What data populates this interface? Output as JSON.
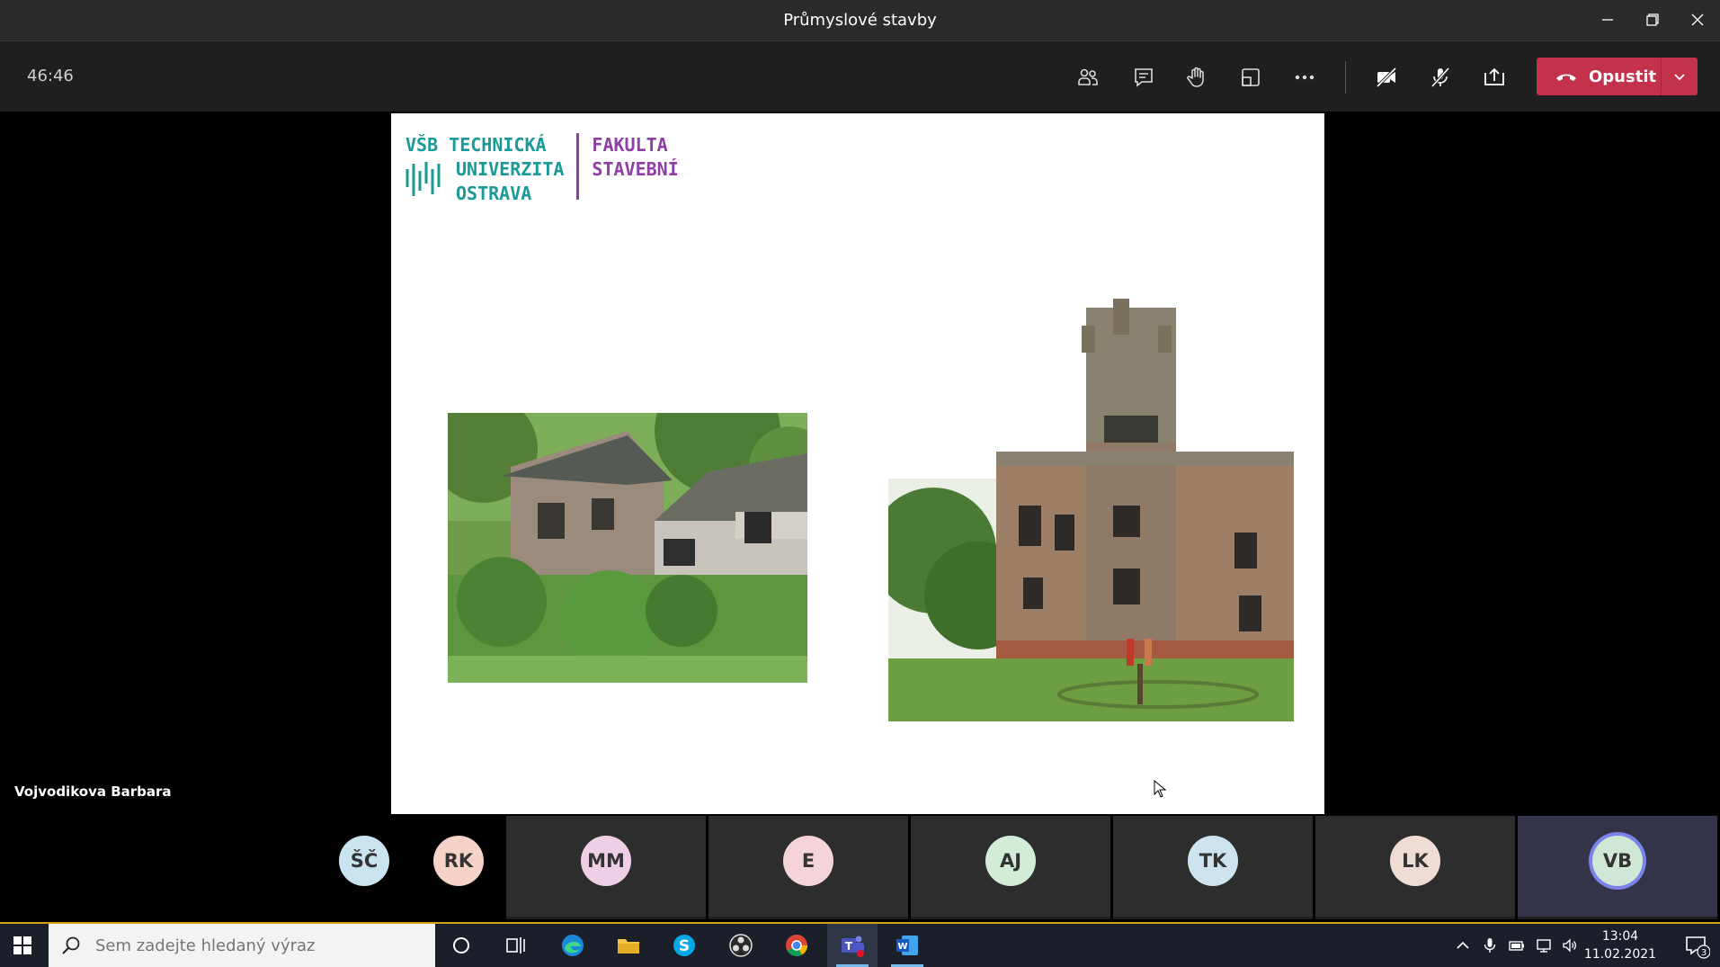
{
  "window": {
    "title": "Průmyslové stavby"
  },
  "toolbar": {
    "timer": "46:46",
    "leave_label": "Opustit",
    "accent": "#c4314b"
  },
  "slide": {
    "logo_left": [
      "VŠB TECHNICKÁ",
      "UNIVERZITA",
      "OSTRAVA"
    ],
    "logo_right": [
      "FAKULTA",
      "STAVEBNÍ"
    ],
    "logo_color_left": "#1a9a96",
    "logo_color_right": "#8e3ea5"
  },
  "speaker_name": "Vojvodikova Barbara",
  "participants": [
    {
      "initials": "ŠČ",
      "color": "#c9e4ee"
    },
    {
      "initials": "RK",
      "color": "#f6d2c8"
    },
    {
      "initials": "MM",
      "color": "#efcfe6"
    },
    {
      "initials": "E",
      "color": "#f4d4d8"
    },
    {
      "initials": "AJ",
      "color": "#d3ecd6"
    },
    {
      "initials": "TK",
      "color": "#cfe3ef"
    },
    {
      "initials": "LK",
      "color": "#eedcd5"
    },
    {
      "initials": "VB",
      "color": "#cfe7d4"
    }
  ],
  "taskbar": {
    "search_placeholder": "Sem zadejte hledaný výraz",
    "time": "13:04",
    "date": "11.02.2021",
    "notification_count": "3"
  }
}
